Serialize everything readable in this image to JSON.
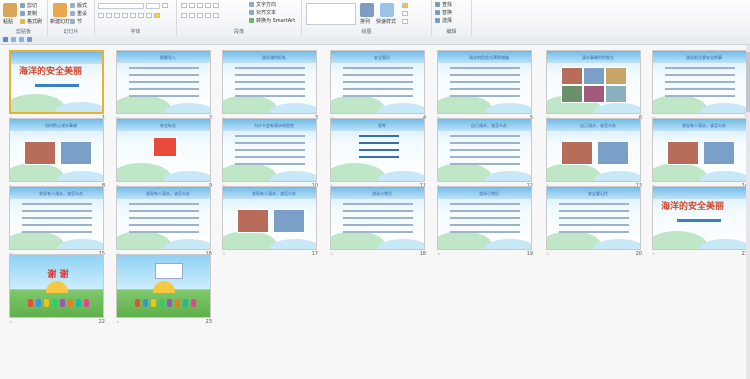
{
  "ribbon": {
    "clipboard": {
      "group_label": "剪贴板",
      "paste": "粘贴",
      "cut": "剪切",
      "copy": "复制",
      "format_painter": "格式刷"
    },
    "slides": {
      "group_label": "幻灯片",
      "new_slide": "新建幻灯片",
      "layout": "版式",
      "reset": "重设",
      "section": "节"
    },
    "font": {
      "group_label": "字体"
    },
    "paragraph": {
      "group_label": "段落",
      "text_direction": "文字方向",
      "align_text": "对齐文本",
      "smartart": "转换为 SmartArt"
    },
    "drawing": {
      "group_label": "绘图",
      "arrange": "排列",
      "quick_styles": "快速样式"
    },
    "editing": {
      "group_label": "编辑",
      "find": "查找",
      "replace": "替换",
      "select": "选择"
    }
  },
  "slides": [
    {
      "n": "1",
      "title": "",
      "big": "海洋的安全美丽",
      "kind": "cover",
      "selected": true
    },
    {
      "n": "2",
      "title": "情景导入",
      "kind": "text"
    },
    {
      "n": "3",
      "title": "游泳课的好处",
      "kind": "text"
    },
    {
      "n": "4",
      "title": "安全意识",
      "kind": "text"
    },
    {
      "n": "5",
      "title": "溺水的危险与预防措施",
      "kind": "text"
    },
    {
      "n": "6",
      "title": "溺水事故时时发生",
      "kind": "photos"
    },
    {
      "n": "7",
      "title": "游泳前注意安全的事",
      "kind": "list"
    },
    {
      "n": "8",
      "title": "如何防止溺水事故",
      "kind": "photos2"
    },
    {
      "n": "9",
      "title": "安全标志",
      "kind": "sign"
    },
    {
      "n": "10",
      "title": "为什么会有溺水的危险",
      "kind": "text"
    },
    {
      "n": "11",
      "title": "思考",
      "kind": "questions"
    },
    {
      "n": "12",
      "title": "自己溺水，该怎么办",
      "kind": "text"
    },
    {
      "n": "13",
      "title": "自己溺水，该怎么办",
      "kind": "photos3"
    },
    {
      "n": "14",
      "title": "发现有人溺水，该怎么办",
      "kind": "photos4"
    },
    {
      "n": "15",
      "title": "发现有人溺水，该怎么办",
      "kind": "text"
    },
    {
      "n": "16",
      "title": "发现有人溺水，该怎么办",
      "kind": "text"
    },
    {
      "n": "17",
      "title": "发现有人溺水，该怎么办",
      "kind": "photos5"
    },
    {
      "n": "18",
      "title": "游泳小常识",
      "kind": "text"
    },
    {
      "n": "19",
      "title": "游泳小常识",
      "kind": "text"
    },
    {
      "n": "20",
      "title": "安全要记住",
      "kind": "text"
    },
    {
      "n": "21",
      "title": "",
      "big": "海洋的安全美丽",
      "kind": "cover"
    },
    {
      "n": "22",
      "title": "",
      "big": "谢 谢",
      "kind": "final"
    },
    {
      "n": "23",
      "title": "",
      "big": "",
      "kind": "final2"
    }
  ]
}
